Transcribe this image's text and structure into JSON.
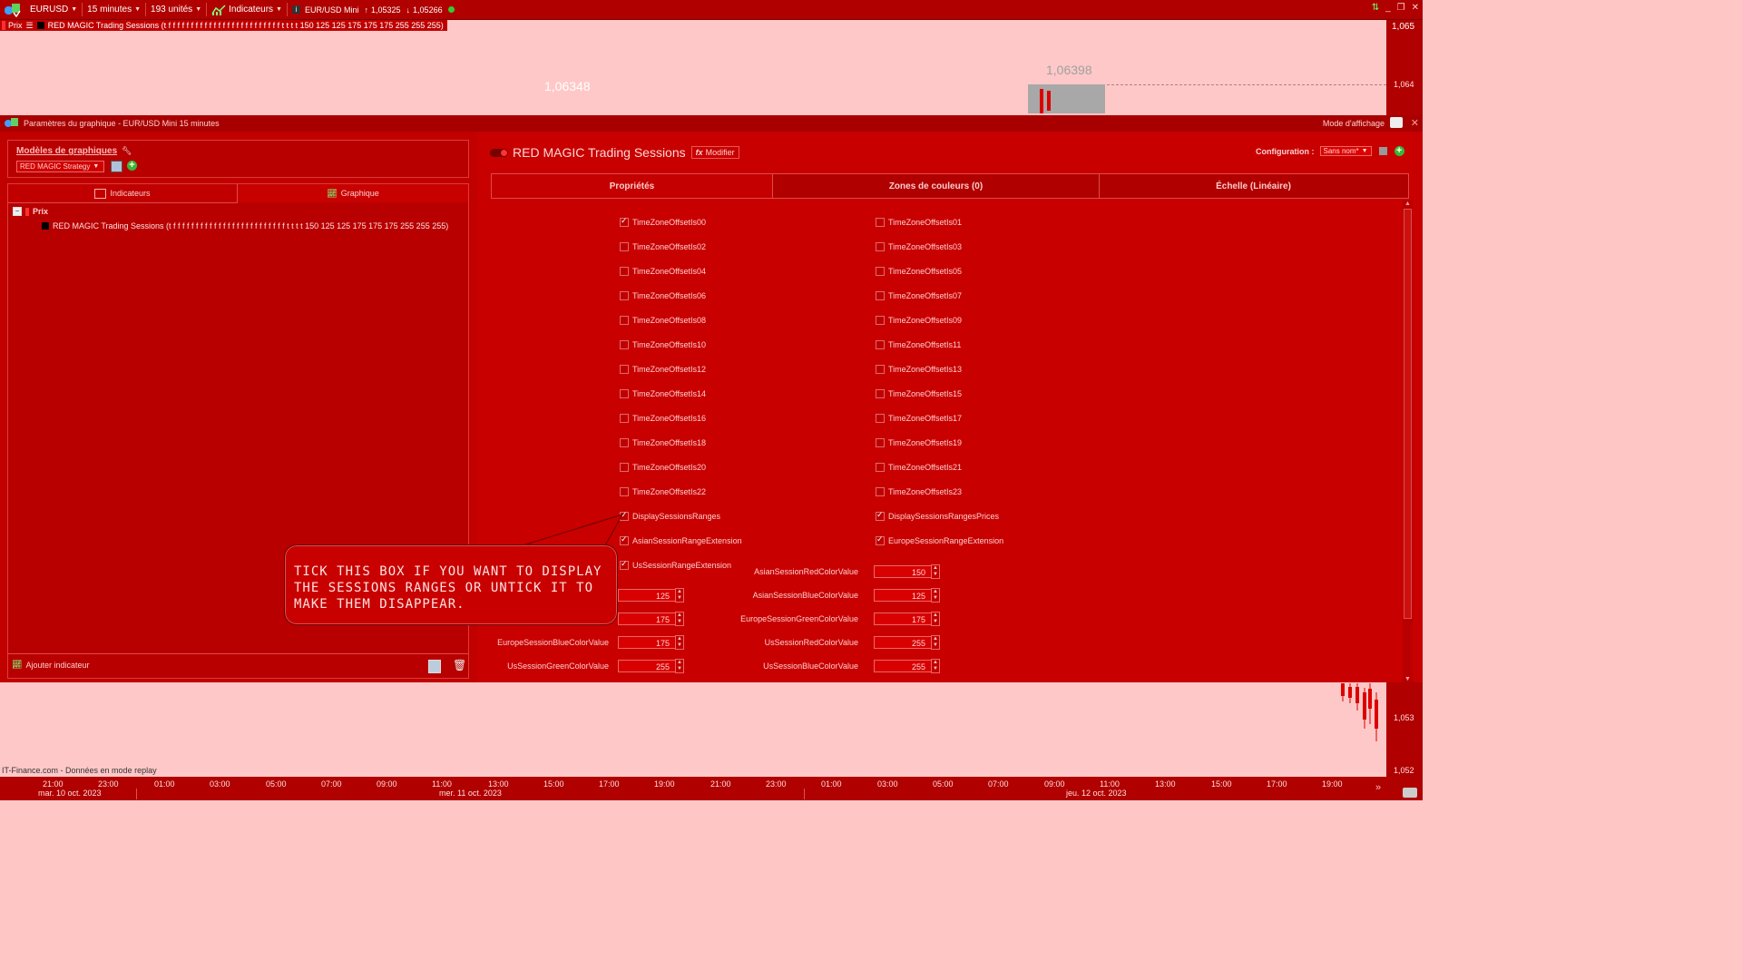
{
  "toolbar": {
    "symbol": "EURUSD",
    "timeframe": "15 minutes",
    "units": "193 unités",
    "indicators": "Indicateurs",
    "instrument": "EUR/USD Mini",
    "high": "1,05325",
    "low": "1,05266"
  },
  "legend": {
    "price": "Prix",
    "indicator": "RED MAGIC Trading Sessions (t f f f f f f f f f f f f f f f f f f f f f f f f f t t t t 150 125 125 175 175 175 255 255 255)"
  },
  "chart": {
    "label_left": "1,06348",
    "label_right": "1,06398",
    "y_ticks": [
      "1,065",
      "1,064",
      "1,053",
      "1,052"
    ],
    "footer": "IT-Finance.com - Données en mode replay",
    "x_ticks": [
      "21:00",
      "23:00",
      "01:00",
      "03:00",
      "05:00",
      "07:00",
      "09:00",
      "11:00",
      "13:00",
      "15:00",
      "17:00",
      "19:00",
      "21:00",
      "23:00",
      "01:00",
      "03:00",
      "05:00",
      "07:00",
      "09:00",
      "11:00",
      "13:00",
      "15:00",
      "17:00",
      "19:00"
    ],
    "dates": [
      "mar. 10 oct. 2023",
      "mer. 11 oct. 2023",
      "jeu. 12 oct. 2023"
    ]
  },
  "dialog": {
    "title": "Paramètres du graphique - EUR/USD Mini 15 minutes",
    "display_mode": "Mode d'affichage",
    "templates_label": "Modèles de graphiques",
    "template_value": "RED MAGIC Strategy",
    "tab_indicators": "Indicateurs",
    "tab_chart": "Graphique",
    "tree_price": "Prix",
    "tree_indicator": "RED MAGIC Trading Sessions (t f f f f f f f f f f f f f f f f f f f f f f f f f t t t t 150 125 125 175 175 175 255 255 255)",
    "add_indicator": "Ajouter indicateur",
    "indicator_name": "RED MAGIC Trading Sessions",
    "modify": "Modifier",
    "configuration_label": "Configuration :",
    "configuration_value": "Sans nom*",
    "tabs": [
      "Propriétés",
      "Zones de couleurs (0)",
      "Échelle (Linéaire)"
    ]
  },
  "properties": {
    "left_checks": [
      {
        "label": "TimeZoneOffsetIs00",
        "checked": true
      },
      {
        "label": "TimeZoneOffsetIs02",
        "checked": false
      },
      {
        "label": "TimeZoneOffsetIs04",
        "checked": false
      },
      {
        "label": "TimeZoneOffsetIs06",
        "checked": false
      },
      {
        "label": "TimeZoneOffsetIs08",
        "checked": false
      },
      {
        "label": "TimeZoneOffsetIs10",
        "checked": false
      },
      {
        "label": "TimeZoneOffsetIs12",
        "checked": false
      },
      {
        "label": "TimeZoneOffsetIs14",
        "checked": false
      },
      {
        "label": "TimeZoneOffsetIs16",
        "checked": false
      },
      {
        "label": "TimeZoneOffsetIs18",
        "checked": false
      },
      {
        "label": "TimeZoneOffsetIs20",
        "checked": false
      },
      {
        "label": "TimeZoneOffsetIs22",
        "checked": false
      },
      {
        "label": "DisplaySessionsRanges",
        "checked": true
      },
      {
        "label": "AsianSessionRangeExtension",
        "checked": true
      },
      {
        "label": "UsSessionRangeExtension",
        "checked": true
      }
    ],
    "right_checks": [
      {
        "label": "TimeZoneOffsetIs01",
        "checked": false
      },
      {
        "label": "TimeZoneOffsetIs03",
        "checked": false
      },
      {
        "label": "TimeZoneOffsetIs05",
        "checked": false
      },
      {
        "label": "TimeZoneOffsetIs07",
        "checked": false
      },
      {
        "label": "TimeZoneOffsetIs09",
        "checked": false
      },
      {
        "label": "TimeZoneOffsetIs11",
        "checked": false
      },
      {
        "label": "TimeZoneOffsetIs13",
        "checked": false
      },
      {
        "label": "TimeZoneOffsetIs15",
        "checked": false
      },
      {
        "label": "TimeZoneOffsetIs17",
        "checked": false
      },
      {
        "label": "TimeZoneOffsetIs19",
        "checked": false
      },
      {
        "label": "TimeZoneOffsetIs21",
        "checked": false
      },
      {
        "label": "TimeZoneOffsetIs23",
        "checked": false
      },
      {
        "label": "DisplaySessionsRangesPrices",
        "checked": true
      },
      {
        "label": "EuropeSessionRangeExtension",
        "checked": true
      }
    ],
    "numeric_left": [
      {
        "label": "",
        "value": "125"
      },
      {
        "label": "",
        "value": "175"
      },
      {
        "label": "EuropeSessionBlueColorValue",
        "value": "175"
      },
      {
        "label": "UsSessionGreenColorValue",
        "value": "255"
      }
    ],
    "numeric_right": [
      {
        "label": "AsianSessionRedColorValue",
        "value": "150"
      },
      {
        "label": "AsianSessionBlueColorValue",
        "value": "125"
      },
      {
        "label": "EuropeSessionGreenColorValue",
        "value": "175"
      },
      {
        "label": "UsSessionRedColorValue",
        "value": "255"
      },
      {
        "label": "UsSessionBlueColorValue",
        "value": "255"
      }
    ]
  },
  "callout": "TICK THIS BOX IF YOU WANT TO DISPLAY THE SESSIONS RANGES OR UNTICK IT TO MAKE THEM DISAPPEAR.",
  "colors": {
    "accent": "#b00000",
    "panel": "#c10000",
    "chart_bg": "#ffc8c8"
  }
}
